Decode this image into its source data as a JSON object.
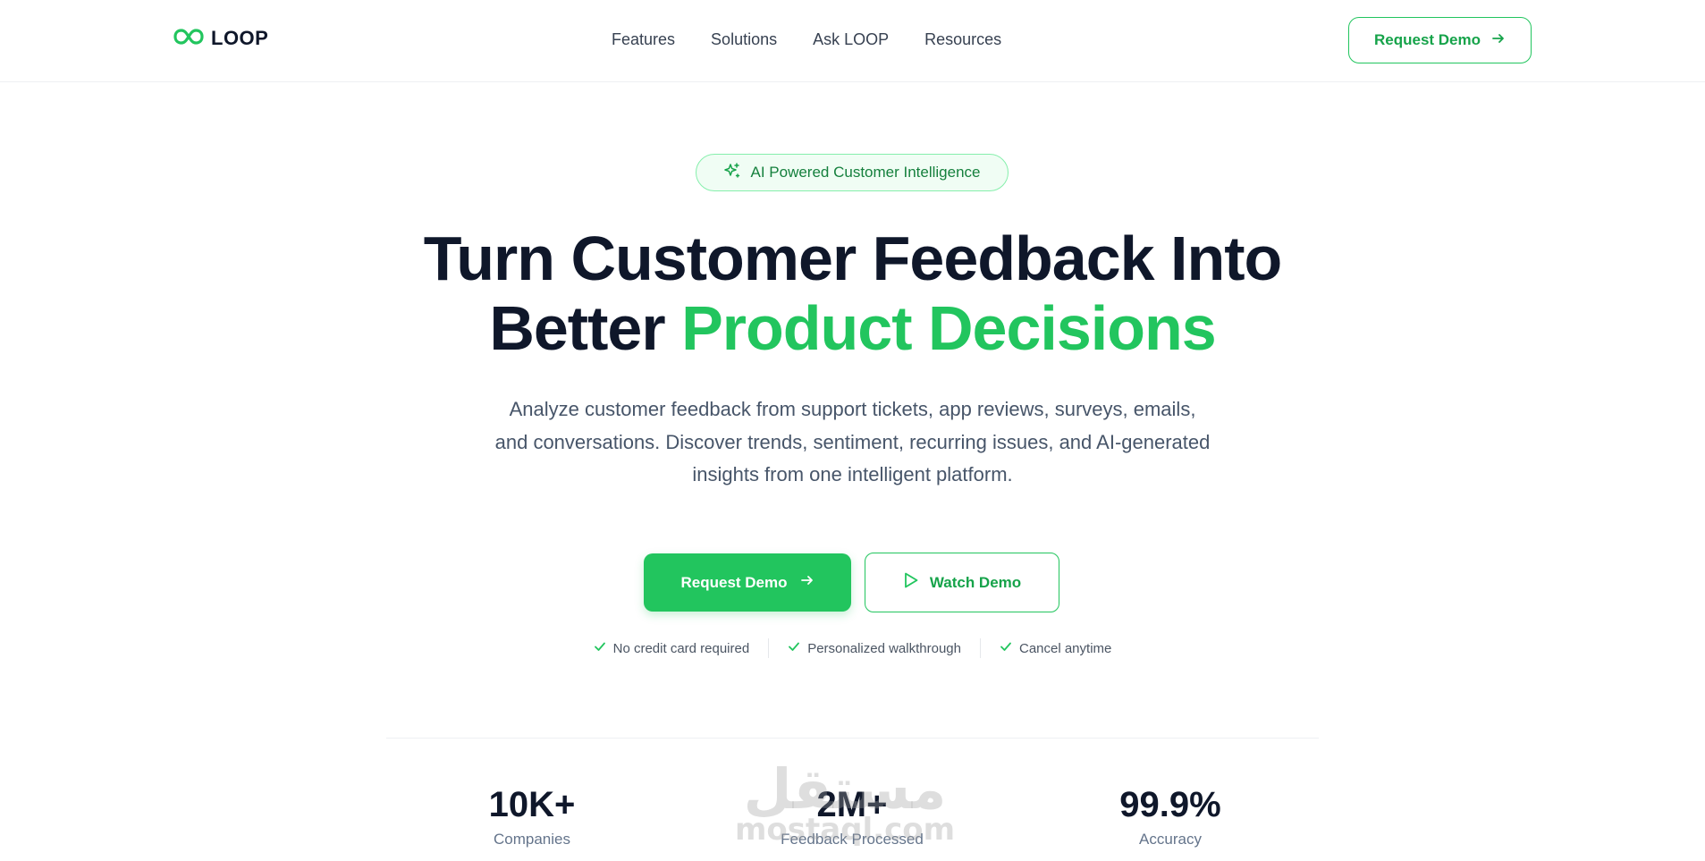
{
  "brand": {
    "name": "LOOP",
    "accent": "#22c55e",
    "logo_icon": "infinity-icon"
  },
  "nav": {
    "links": [
      "Features",
      "Solutions",
      "Ask LOOP",
      "Resources"
    ],
    "cta_label": "Request Demo"
  },
  "hero": {
    "badge": "AI Powered Customer Intelligence",
    "badge_icon": "sparkles-icon",
    "title_line1": "Turn Customer Feedback Into",
    "title_line2_plain": "Better ",
    "title_line2_accent": "Product Decisions",
    "subtitle_line1": "Analyze customer feedback from support tickets, app reviews, surveys, emails,",
    "subtitle_line2": "and conversations. Discover trends, sentiment, recurring issues, and AI-generated",
    "subtitle_line3": "insights from one intelligent platform.",
    "primary_cta": "Request Demo",
    "secondary_cta": "Watch Demo",
    "checks": [
      "No credit card required",
      "Personalized walkthrough",
      "Cancel anytime"
    ]
  },
  "stats": [
    {
      "value": "10K+",
      "label": "Companies"
    },
    {
      "value": "2M+",
      "label": "Feedback Processed"
    },
    {
      "value": "99.9%",
      "label": "Accuracy"
    }
  ],
  "watermark": {
    "arabic": "مستقل",
    "latin": "mostaql.com"
  }
}
